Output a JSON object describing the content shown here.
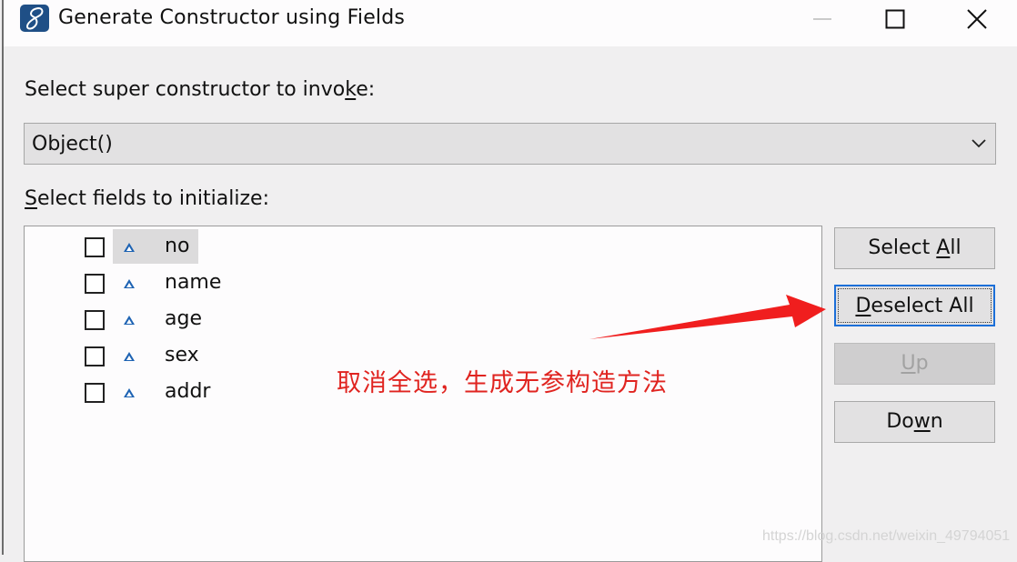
{
  "window": {
    "title": "Generate Constructor using Fields",
    "icon": "eclipse-app-icon",
    "controls": {
      "minimize": "minimize-icon",
      "maximize": "maximize-icon",
      "close": "close-icon"
    }
  },
  "super_constructor": {
    "label_before": "Select super constructor to invo",
    "label_mnemonic": "k",
    "label_after": "e:",
    "selected": "Object()"
  },
  "fields": {
    "label_mnemonic": "S",
    "label_rest": "elect fields to initialize:",
    "items": [
      {
        "name": "no",
        "checked": false,
        "highlighted": true,
        "icon": "field-default-icon"
      },
      {
        "name": "name",
        "checked": false,
        "highlighted": false,
        "icon": "field-default-icon"
      },
      {
        "name": "age",
        "checked": false,
        "highlighted": false,
        "icon": "field-default-icon"
      },
      {
        "name": "sex",
        "checked": false,
        "highlighted": false,
        "icon": "field-default-icon"
      },
      {
        "name": "addr",
        "checked": false,
        "highlighted": false,
        "icon": "field-default-icon"
      }
    ]
  },
  "buttons": {
    "select_all": {
      "before": "Select ",
      "mnemonic": "A",
      "after": "ll",
      "enabled": true
    },
    "deselect_all": {
      "before": "",
      "mnemonic": "D",
      "after": "eselect All",
      "enabled": true,
      "focused": true
    },
    "up": {
      "before": "",
      "mnemonic": "U",
      "after": "p",
      "enabled": false
    },
    "down": {
      "before": "Do",
      "mnemonic": "w",
      "after": "n",
      "enabled": true
    }
  },
  "annotation": {
    "text": "取消全选，生成无参构造方法",
    "color": "#e02420"
  },
  "watermark": "https://blog.csdn.net/weixin_49794051"
}
